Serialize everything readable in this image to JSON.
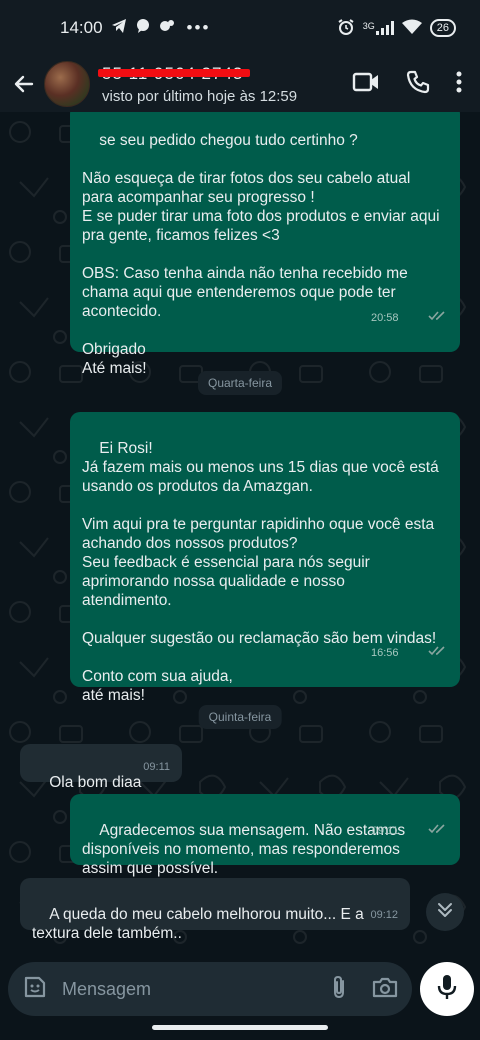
{
  "status_bar": {
    "time": "14:00",
    "network": "3G",
    "battery": "26"
  },
  "header": {
    "contact_name": "55 11 9564 2743",
    "last_seen": "visto por último hoje às 12:59"
  },
  "messages": [
    {
      "kind": "out",
      "text": "se seu pedido chegou tudo certinho ?\n\nNão esqueça de tirar fotos dos seu cabelo atual\npara acompanhar seu progresso !\nE se puder tirar uma foto dos produtos e enviar aqui\npra gente, ficamos felizes <3\n\nOBS: Caso tenha ainda não tenha recebido me\nchama aqui que entenderemos oque pode ter\nacontecido.\n\nObrigado\nAté mais!",
      "time": "20:58",
      "ticks": "read"
    },
    {
      "kind": "day",
      "text": "Quarta-feira"
    },
    {
      "kind": "out",
      "text": "Ei Rosi!\nJá fazem mais ou menos uns 15 dias que você está\nusando os produtos da Amazgan.\n\nVim aqui pra te perguntar rapidinho oque você esta\nachando dos nossos produtos?\nSeu feedback é essencial para nós seguir\naprimorando nossa qualidade e nosso\natendimento.\n\nQualquer sugestão ou reclamação são bem vindas!\n\nConto com sua ajuda,\naté mais!",
      "time": "16:56",
      "ticks": "read"
    },
    {
      "kind": "day",
      "text": "Quinta-feira"
    },
    {
      "kind": "in",
      "text": "Ola bom diaa",
      "time": "09:11"
    },
    {
      "kind": "out",
      "text": "Agradecemos sua mensagem. Não estamos\ndisponíveis no momento, mas responderemos\nassim que possível.",
      "time": "09:11",
      "ticks": "read"
    },
    {
      "kind": "in",
      "text": "A queda do meu cabelo melhorou muito... E a\ntextura dele também..",
      "time": "09:12"
    }
  ],
  "composer": {
    "placeholder": "Mensagem"
  },
  "colors": {
    "outgoing": "#005c4b",
    "incoming": "#202c33",
    "background": "#0b141a",
    "read_ticks": "#53bdeb"
  },
  "icons": [
    "back-arrow-icon",
    "video-call-icon",
    "phone-icon",
    "more-options-icon",
    "scroll-down-icon",
    "sticker-icon",
    "attach-icon",
    "camera-icon",
    "mic-icon"
  ]
}
